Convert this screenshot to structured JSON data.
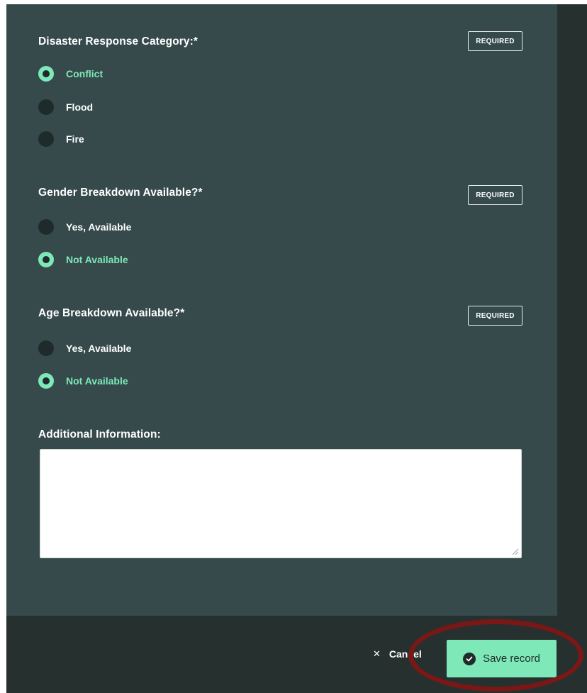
{
  "questions": [
    {
      "label": "Disaster Response Category:*",
      "badge": "REQUIRED",
      "options": [
        {
          "label": "Conflict",
          "selected": true
        },
        {
          "label": "Flood",
          "selected": false
        },
        {
          "label": "Fire",
          "selected": false
        }
      ]
    },
    {
      "label": "Gender Breakdown Available?*",
      "badge": "REQUIRED",
      "options": [
        {
          "label": "Yes, Available",
          "selected": false
        },
        {
          "label": "Not Available",
          "selected": true
        }
      ]
    },
    {
      "label": "Age Breakdown Available?*",
      "badge": "REQUIRED",
      "options": [
        {
          "label": "Yes, Available",
          "selected": false
        },
        {
          "label": "Not Available",
          "selected": true
        }
      ]
    }
  ],
  "additional_info": {
    "label": "Additional Information:",
    "value": ""
  },
  "footer": {
    "cancel_label": "Cancel",
    "cancel_icon": "close-icon",
    "save_label": "Save record",
    "save_icon": "check-circle-icon"
  },
  "colors": {
    "accent": "#7ee8b8",
    "panel": "#364a4b",
    "footer": "#26302f",
    "highlight": "#7a1717"
  }
}
